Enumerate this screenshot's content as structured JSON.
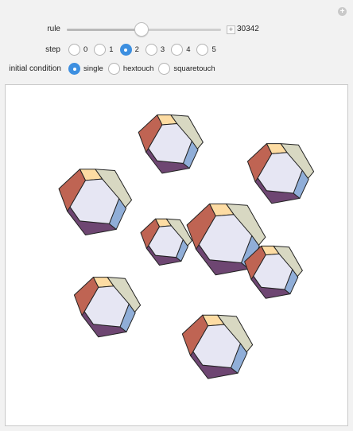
{
  "controls": {
    "rule": {
      "label": "rule",
      "value": "30342",
      "slider_fraction": 0.48
    },
    "step": {
      "label": "step",
      "options": [
        "0",
        "1",
        "2",
        "3",
        "4",
        "5"
      ],
      "selected": "2"
    },
    "initial_condition": {
      "label": "initial condition",
      "options": [
        "single",
        "hextouch",
        "squaretouch"
      ],
      "selected": "single"
    }
  },
  "colors": {
    "top_square": "#fddca3",
    "left_hex": "#bf6453",
    "front_hex": "#e6e6f3",
    "bottom_square": "#6e4672",
    "right_square": "#90aed8",
    "back_square": "#d8d8c2",
    "selected_radio": "#3d8fe0"
  }
}
